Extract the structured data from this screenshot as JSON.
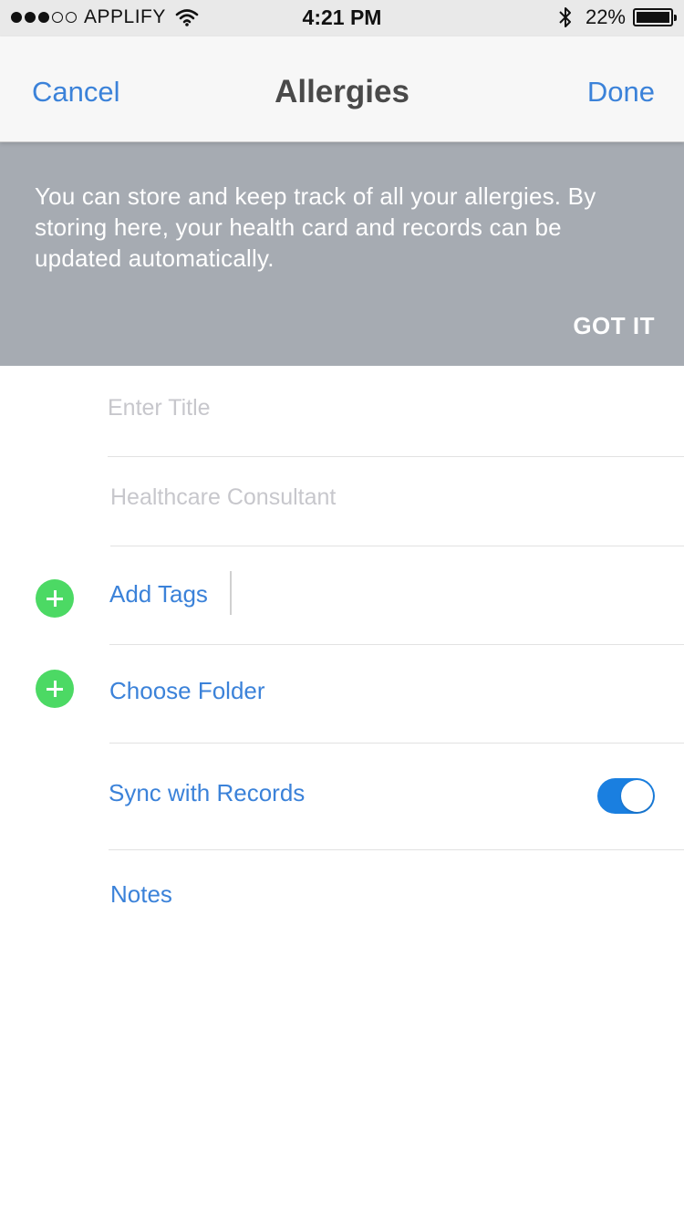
{
  "status_bar": {
    "carrier": "APPLIFY",
    "time": "4:21 PM",
    "battery_percent": "22%",
    "battery_level": 0.22
  },
  "nav": {
    "cancel_label": "Cancel",
    "title": "Allergies",
    "done_label": "Done"
  },
  "banner": {
    "text": "You can store and keep track of all your allergies. By storing here, your health card and records can be updated automatically.",
    "action_label": "GOT IT"
  },
  "form": {
    "title_placeholder": "Enter Title",
    "consultant_placeholder": "Healthcare Consultant",
    "add_tags_label": "Add Tags",
    "choose_folder_label": "Choose Folder",
    "sync_label": "Sync with Records",
    "sync_enabled": true,
    "notes_label": "Notes"
  },
  "colors": {
    "accent": "#3b82d9",
    "banner_bg": "#a6abb2",
    "add_icon": "#4cd964",
    "toggle_on": "#1a7fe0"
  },
  "icons": [
    "wifi-icon",
    "bluetooth-icon",
    "battery-icon",
    "plus-icon"
  ]
}
